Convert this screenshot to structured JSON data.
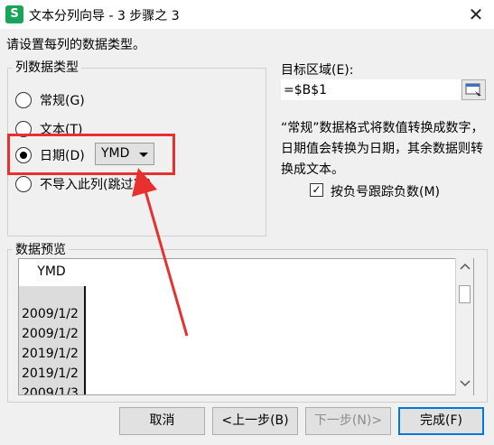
{
  "window": {
    "app_icon_text": "S",
    "title": "文本分列向导 - 3 步骤之 3",
    "close_glyph": "✕"
  },
  "instruction": "请设置每列的数据类型。",
  "column_type": {
    "legend": "列数据类型",
    "options": [
      {
        "label": "常规(G)",
        "checked": false
      },
      {
        "label": "文本(T)",
        "checked": false
      },
      {
        "label": "日期(D)",
        "checked": true
      },
      {
        "label": "不导入此列(跳过)(I)",
        "checked": false
      }
    ],
    "date_format_value": "YMD"
  },
  "destination": {
    "label": "目标区域(E):",
    "value": "=$B$1"
  },
  "description": "“常规”数据格式将数值转换成数字，日期值会转换为日期，其余数据则转换成文本。",
  "negative_checkbox": {
    "label": "按负号跟踪负数(M)",
    "checked": true,
    "check_glyph": "✓"
  },
  "preview": {
    "legend": "数据预览",
    "header": "YMD",
    "rows": [
      "2009/1/2",
      "2009/1/2",
      "2019/1/2",
      "2019/1/2",
      "2009/1/3"
    ]
  },
  "buttons": {
    "cancel": "取消",
    "back": "<上一步(B)",
    "next": "下一步(N)>",
    "finish": "完成(F)"
  },
  "accent_colors": {
    "highlight_red": "#e8312e",
    "app_green": "#1aa35a"
  }
}
